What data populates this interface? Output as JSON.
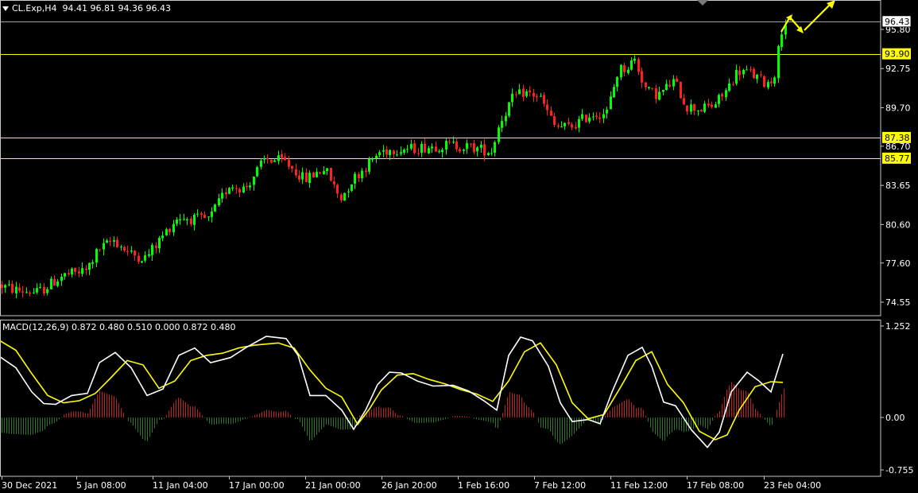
{
  "header": {
    "symbol": "CL.Exp,H4",
    "ohlc": "94.41 96.81 94.36 96.43",
    "dropdown_icon": "triangle-down-icon"
  },
  "macd": {
    "label": "MACD(12,26,9) 0.872 0.480 0.510 0.000 0.872 0.480",
    "scale_labels": [
      "1.252",
      "0.00",
      "-0.755"
    ]
  },
  "price_axis": {
    "ticks": [
      "95.80",
      "92.75",
      "89.70",
      "86.70",
      "83.65",
      "80.60",
      "77.60",
      "74.55"
    ],
    "tick_values": [
      95.8,
      92.75,
      89.7,
      86.7,
      83.65,
      80.6,
      77.6,
      74.55
    ]
  },
  "levels": [
    {
      "label": "96.43",
      "value": 96.43,
      "style": "current"
    },
    {
      "label": "93.90",
      "value": 93.9,
      "style": "yellow"
    },
    {
      "label": "87.38",
      "value": 87.38,
      "style": "yellow"
    },
    {
      "label": "85.77",
      "value": 85.77,
      "style": "yellow"
    }
  ],
  "time_axis": [
    "30 Dec 2021",
    "5 Jan 08:00",
    "11 Jan 04:00",
    "17 Jan 00:00",
    "21 Jan 00:00",
    "26 Jan 20:00",
    "1 Feb 16:00",
    "7 Feb 12:00",
    "11 Feb 12:00",
    "17 Feb 08:00",
    "23 Feb 04:00"
  ],
  "colors": {
    "bull": "#00ff00",
    "bear": "#ff2020",
    "level_line": "#ffff00",
    "signal_line": "#ffff00",
    "macd_line": "#ffffff",
    "hist_pos": "#c02020",
    "hist_neg": "#2a7a2a",
    "grid": "#c0c0c0"
  },
  "chart_data": {
    "type": "candlestick",
    "price_trend": [
      [
        0,
        75.9
      ],
      [
        20,
        75.5
      ],
      [
        50,
        75.3
      ],
      [
        80,
        76.6
      ],
      [
        110,
        77.0
      ],
      [
        125,
        78.6
      ],
      [
        145,
        79.4
      ],
      [
        165,
        78.3
      ],
      [
        185,
        78.0
      ],
      [
        205,
        79.6
      ],
      [
        225,
        81.2
      ],
      [
        245,
        81.0
      ],
      [
        265,
        81.0
      ],
      [
        290,
        83.7
      ],
      [
        310,
        83.4
      ],
      [
        335,
        85.7
      ],
      [
        360,
        85.5
      ],
      [
        385,
        84.1
      ],
      [
        410,
        85.0
      ],
      [
        430,
        82.6
      ],
      [
        445,
        84.1
      ],
      [
        460,
        85.0
      ],
      [
        480,
        86.3
      ],
      [
        500,
        86.5
      ],
      [
        520,
        86.5
      ],
      [
        545,
        86.7
      ],
      [
        570,
        86.8
      ],
      [
        595,
        86.6
      ],
      [
        620,
        86.3
      ],
      [
        630,
        88.5
      ],
      [
        645,
        90.3
      ],
      [
        660,
        90.9
      ],
      [
        680,
        90.6
      ],
      [
        700,
        88.2
      ],
      [
        720,
        88.2
      ],
      [
        745,
        89.2
      ],
      [
        765,
        89.3
      ],
      [
        780,
        92.7
      ],
      [
        790,
        92.8
      ],
      [
        800,
        93.5
      ],
      [
        815,
        91.0
      ],
      [
        830,
        90.7
      ],
      [
        850,
        91.8
      ],
      [
        865,
        89.8
      ],
      [
        885,
        89.6
      ],
      [
        900,
        89.9
      ],
      [
        915,
        91.0
      ],
      [
        930,
        92.6
      ],
      [
        945,
        92.4
      ],
      [
        965,
        91.6
      ],
      [
        975,
        91.9
      ],
      [
        985,
        95.8
      ],
      [
        990,
        96.4
      ]
    ],
    "macd_line": [
      [
        0,
        0.83
      ],
      [
        20,
        0.68
      ],
      [
        40,
        0.35
      ],
      [
        55,
        0.19
      ],
      [
        70,
        0.18
      ],
      [
        90,
        0.3
      ],
      [
        110,
        0.33
      ],
      [
        125,
        0.75
      ],
      [
        145,
        0.89
      ],
      [
        165,
        0.68
      ],
      [
        185,
        0.3
      ],
      [
        205,
        0.39
      ],
      [
        225,
        0.85
      ],
      [
        245,
        0.95
      ],
      [
        265,
        0.75
      ],
      [
        290,
        0.82
      ],
      [
        310,
        0.96
      ],
      [
        335,
        1.11
      ],
      [
        360,
        1.08
      ],
      [
        375,
        0.85
      ],
      [
        390,
        0.3
      ],
      [
        410,
        0.3
      ],
      [
        430,
        0.1
      ],
      [
        445,
        -0.17
      ],
      [
        460,
        0.1
      ],
      [
        475,
        0.45
      ],
      [
        490,
        0.62
      ],
      [
        505,
        0.61
      ],
      [
        525,
        0.5
      ],
      [
        545,
        0.43
      ],
      [
        570,
        0.44
      ],
      [
        590,
        0.36
      ],
      [
        610,
        0.22
      ],
      [
        625,
        0.1
      ],
      [
        640,
        0.85
      ],
      [
        655,
        1.1
      ],
      [
        670,
        1.05
      ],
      [
        690,
        0.7
      ],
      [
        705,
        0.2
      ],
      [
        720,
        -0.06
      ],
      [
        740,
        -0.03
      ],
      [
        755,
        -0.09
      ],
      [
        770,
        0.35
      ],
      [
        790,
        0.85
      ],
      [
        808,
        0.96
      ],
      [
        820,
        0.7
      ],
      [
        835,
        0.21
      ],
      [
        850,
        0.16
      ],
      [
        870,
        -0.18
      ],
      [
        890,
        -0.43
      ],
      [
        905,
        -0.21
      ],
      [
        920,
        0.35
      ],
      [
        940,
        0.62
      ],
      [
        955,
        0.5
      ],
      [
        970,
        0.35
      ],
      [
        985,
        0.87
      ]
    ],
    "signal_line": [
      [
        0,
        1.05
      ],
      [
        20,
        0.92
      ],
      [
        40,
        0.6
      ],
      [
        60,
        0.3
      ],
      [
        80,
        0.2
      ],
      [
        100,
        0.23
      ],
      [
        120,
        0.33
      ],
      [
        140,
        0.55
      ],
      [
        160,
        0.78
      ],
      [
        180,
        0.72
      ],
      [
        200,
        0.4
      ],
      [
        220,
        0.5
      ],
      [
        240,
        0.78
      ],
      [
        260,
        0.85
      ],
      [
        280,
        0.88
      ],
      [
        300,
        0.95
      ],
      [
        320,
        0.99
      ],
      [
        350,
        1.02
      ],
      [
        370,
        0.95
      ],
      [
        390,
        0.65
      ],
      [
        410,
        0.4
      ],
      [
        430,
        0.28
      ],
      [
        450,
        -0.1
      ],
      [
        465,
        0.12
      ],
      [
        480,
        0.38
      ],
      [
        500,
        0.58
      ],
      [
        520,
        0.6
      ],
      [
        540,
        0.52
      ],
      [
        560,
        0.46
      ],
      [
        580,
        0.38
      ],
      [
        600,
        0.32
      ],
      [
        620,
        0.22
      ],
      [
        640,
        0.5
      ],
      [
        660,
        0.9
      ],
      [
        680,
        1.02
      ],
      [
        700,
        0.72
      ],
      [
        720,
        0.2
      ],
      [
        740,
        -0.02
      ],
      [
        760,
        0.04
      ],
      [
        780,
        0.4
      ],
      [
        800,
        0.78
      ],
      [
        820,
        0.9
      ],
      [
        840,
        0.45
      ],
      [
        860,
        0.2
      ],
      [
        880,
        -0.2
      ],
      [
        900,
        -0.32
      ],
      [
        915,
        -0.25
      ],
      [
        930,
        0.1
      ],
      [
        950,
        0.42
      ],
      [
        970,
        0.49
      ],
      [
        985,
        0.48
      ]
    ],
    "forecast_arrows": "zigzag-up-arrow"
  }
}
